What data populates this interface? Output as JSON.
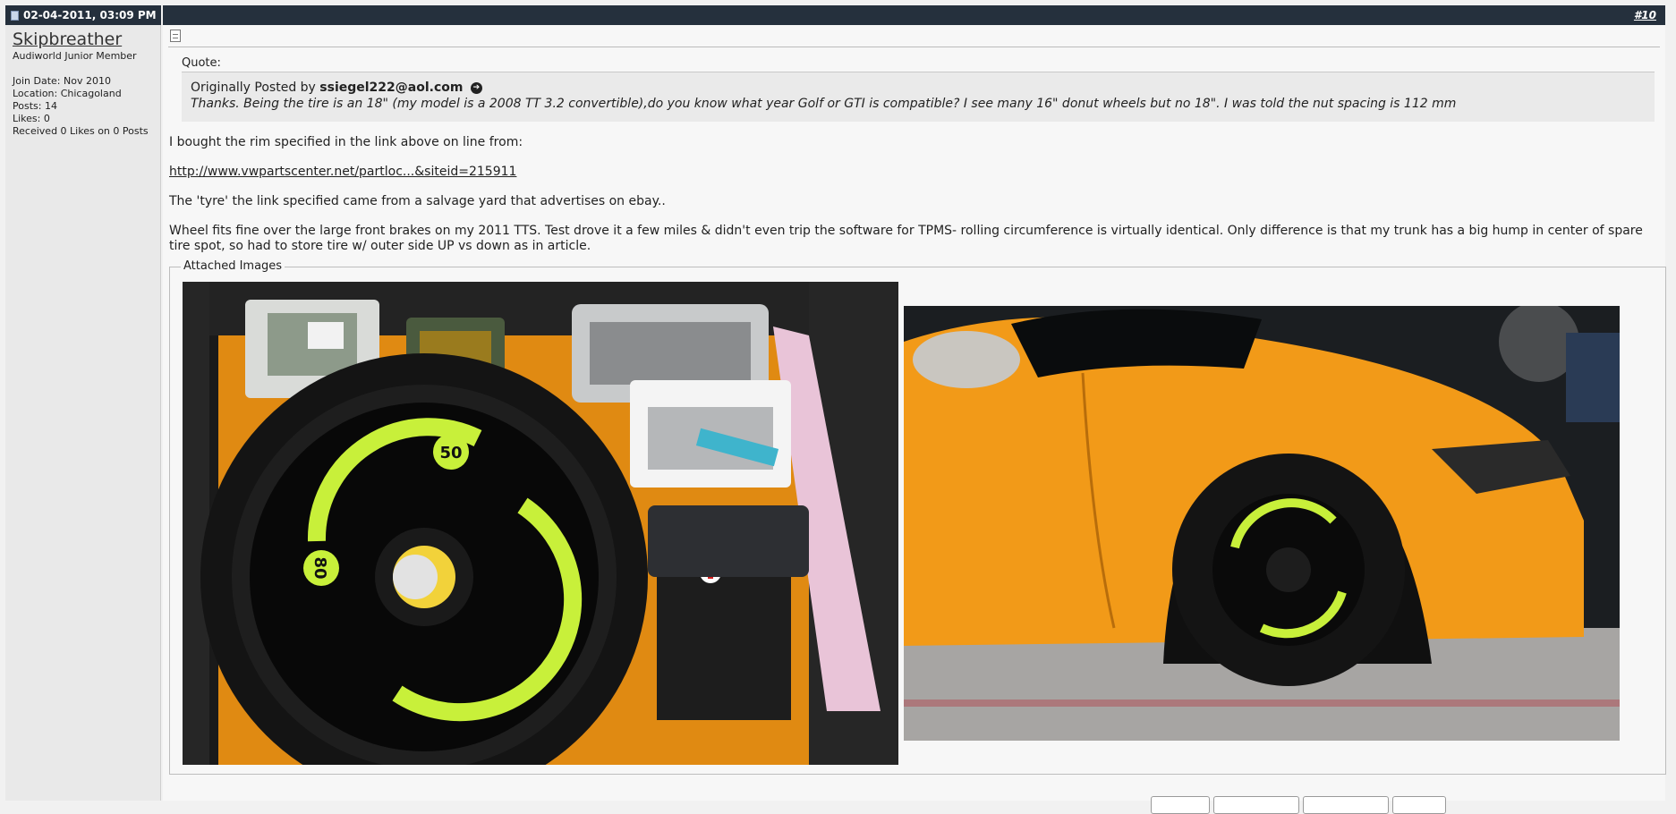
{
  "post": {
    "date": "02-04-2011, 03:09 PM",
    "number": "#10"
  },
  "user": {
    "name": "Skipbreather",
    "title": "Audiworld Junior Member",
    "join_date": "Join Date: Nov 2010",
    "location": "Location: Chicagoland",
    "posts": "Posts: 14",
    "likes": "Likes: 0",
    "received": "Received 0 Likes on 0 Posts"
  },
  "quote": {
    "label": "Quote:",
    "prefix": "Originally Posted by",
    "author": "ssiegel222@aol.com",
    "text": "Thanks. Being the tire is an 18\" (my model is a 2008 TT 3.2 convertible),do you know what year Golf or GTI is compatible? I see many 16\" donut wheels but no 18\". I was told the nut spacing is 112 mm"
  },
  "message": {
    "line1": "I bought the rim specified in the link above on line from:",
    "link": "http://www.vwpartscenter.net/partloc...&siteid=215911",
    "line2": "The 'tyre' the link specified came from a salvage yard that advertises on ebay..",
    "line3": "Wheel fits fine over the large front brakes on my 2011 TTS. Test drove it a few miles & didn't even trip the software for TPMS- rolling circumference is virtually identical. Only difference is that my trunk has a big hump in center of spare tire spot, so had to store tire w/ outer side UP vs down as in article."
  },
  "attachments": {
    "label": "Attached Images",
    "tire_labels": [
      "50",
      "80"
    ]
  },
  "colors": {
    "header_bg": "#25303d",
    "car_orange": "#f29a18",
    "tire_label_yellow": "#c8f03a"
  }
}
